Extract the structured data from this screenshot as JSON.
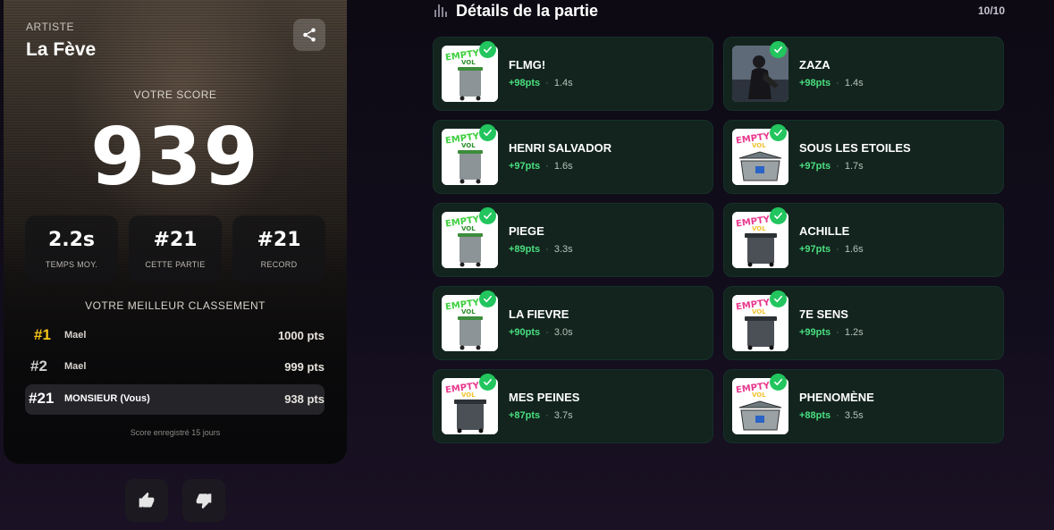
{
  "left_card": {
    "artist_label": "ARTISTE",
    "artist_name": "La Fève",
    "score_label": "VOTRE SCORE",
    "score": "939",
    "stats": [
      {
        "value": "2.2s",
        "label": "TEMPS MOY."
      },
      {
        "value": "#21",
        "label": "CETTE PARTIE"
      },
      {
        "value": "#21",
        "label": "RECORD"
      }
    ],
    "best_label": "VOTRE MEILLEUR CLASSEMENT",
    "leaderboard": [
      {
        "rank": "#1",
        "name": "Mael",
        "points": "1000 pts"
      },
      {
        "rank": "#2",
        "name": "Mael",
        "points": "999 pts"
      },
      {
        "rank": "#21",
        "name": "MONSIEUR (Vous)",
        "points": "938 pts"
      }
    ],
    "saved_note": "Score enregistré 15 jours"
  },
  "details": {
    "title": "Détails de la partie",
    "progress": "10/10",
    "tracks": [
      {
        "title": "FLMG!",
        "points": "+98pts",
        "time": "1.4s",
        "cover": "empty-green-bin"
      },
      {
        "title": "ZAZA",
        "points": "+98pts",
        "time": "1.4s",
        "cover": "photo"
      },
      {
        "title": "HENRI SALVADOR",
        "points": "+97pts",
        "time": "1.6s",
        "cover": "empty-green-bin"
      },
      {
        "title": "SOUS LES ETOILES",
        "points": "+97pts",
        "time": "1.7s",
        "cover": "empty-dumpster"
      },
      {
        "title": "PIEGE",
        "points": "+89pts",
        "time": "3.3s",
        "cover": "empty-green-bin"
      },
      {
        "title": "ACHILLE",
        "points": "+97pts",
        "time": "1.6s",
        "cover": "empty-pink-bin"
      },
      {
        "title": "LA FIEVRE",
        "points": "+90pts",
        "time": "3.0s",
        "cover": "empty-green-bin"
      },
      {
        "title": "7E SENS",
        "points": "+99pts",
        "time": "1.2s",
        "cover": "empty-pink-bin"
      },
      {
        "title": "MES PEINES",
        "points": "+87pts",
        "time": "3.7s",
        "cover": "empty-pink-bin"
      },
      {
        "title": "PHENOMÈNE",
        "points": "+88pts",
        "time": "3.5s",
        "cover": "empty-dumpster"
      }
    ]
  },
  "colors": {
    "accent_green": "#4ade80",
    "check_green": "#22c55e",
    "gold": "#f5c518",
    "track_bg": "#12241d"
  },
  "icons": [
    "share-icon",
    "chart-bars-icon",
    "check-icon",
    "thumbs-up-icon",
    "thumbs-down-icon"
  ]
}
